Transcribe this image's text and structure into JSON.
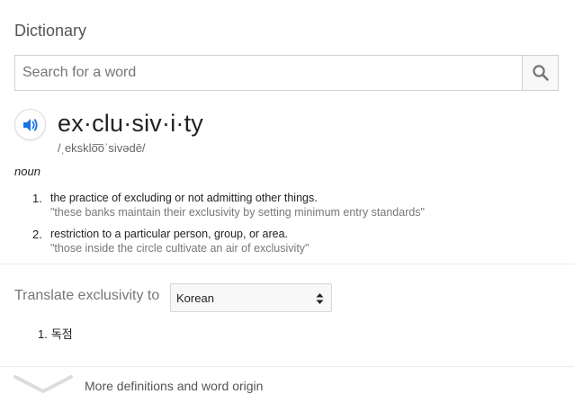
{
  "panel": {
    "title": "Dictionary"
  },
  "search": {
    "placeholder": "Search for a word",
    "value": ""
  },
  "entry": {
    "headword": "ex·clu·siv·i·ty",
    "phonetic": "/ˌeksklo͞oˈsivədē/",
    "part_of_speech": "noun",
    "definitions": [
      {
        "number": "1.",
        "text": "the practice of excluding or not admitting other things.",
        "example": "\"these banks maintain their exclusivity by setting minimum entry standards\""
      },
      {
        "number": "2.",
        "text": "restriction to a particular person, group, or area.",
        "example": "\"those inside the circle cultivate an air of exclusivity\""
      }
    ]
  },
  "translate": {
    "label": "Translate exclusivity to",
    "selected_language": "Korean",
    "results": [
      {
        "number": "1.",
        "text": "독점"
      }
    ]
  },
  "footer": {
    "more_label": "More definitions and word origin"
  },
  "colors": {
    "speaker_blue": "#1a73e8",
    "muted_text": "#777777",
    "border": "#d0d0d0"
  },
  "icons": {
    "search": "search-icon",
    "speaker": "speaker-icon",
    "select_arrows": "select-arrows-icon",
    "expand": "chevron-down-icon"
  }
}
